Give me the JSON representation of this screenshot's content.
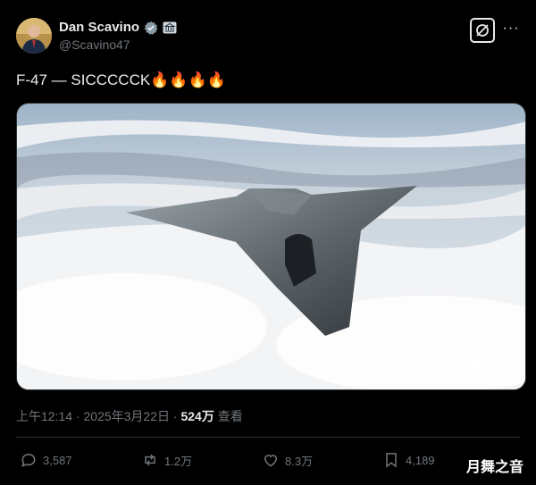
{
  "author": {
    "name": "Dan Scavino",
    "handle": "@Scavino47"
  },
  "tweet": {
    "text": "F-47 — SICCCCCK🔥🔥🔥🔥"
  },
  "meta": {
    "time": "上午12:14",
    "date": "2025年3月22日",
    "views_count": "524万",
    "views_label": "查看"
  },
  "actions": {
    "replies": "3,587",
    "retweets": "1.2万",
    "likes": "8.3万",
    "bookmarks": "4,189"
  },
  "watermark": "月舞之音",
  "colors": {
    "background": "#000000",
    "text": "#e7e9ea",
    "muted": "#71767b",
    "verified": "#8899a6"
  }
}
